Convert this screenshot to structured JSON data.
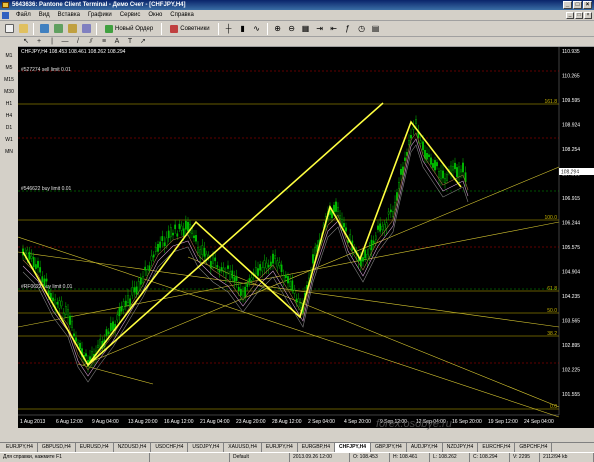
{
  "window": {
    "title": "5643636: Pantone Client Terminal - Демо Счет - [CHFJPY,H4]",
    "controls": [
      "_",
      "□",
      "×"
    ]
  },
  "menu": [
    "Файл",
    "Вид",
    "Вставка",
    "Графики",
    "Сервис",
    "Окно",
    "Справка"
  ],
  "toolbar": {
    "new_order_label": "Новый Ордер",
    "advisors_label": "Советники"
  },
  "timeframes": [
    "M1",
    "M5",
    "M15",
    "M30",
    "H1",
    "H4",
    "D1",
    "W1",
    "MN"
  ],
  "chart": {
    "header": "CHFJPY,H4  108.453 108.461 108.262 108.294",
    "labels": [
      "#527274 sell limit 0.01",
      "#546622 buy limit 0.01",
      "#RF0622 buy limit 0.01"
    ],
    "current_price": "108.294",
    "price_axis": [
      "110.935",
      "110.265",
      "109.595",
      "108.924",
      "108.254",
      "107.585",
      "106.915",
      "106.244",
      "105.575",
      "104.904",
      "104.235",
      "103.565",
      "102.895",
      "102.225",
      "101.555"
    ],
    "fib_labels": [
      "161.8",
      "100.0",
      "61.8",
      "50.0",
      "38.2",
      "23.6",
      "0.0"
    ],
    "time_axis": [
      "1 Aug 2013",
      "6 Aug 12:00",
      "9 Aug 04:00",
      "13 Aug 20:00",
      "16 Aug 12:00",
      "21 Aug 04:00",
      "23 Aug 20:00",
      "28 Aug 12:00",
      "2 Sep 04:00",
      "4 Sep 20:00",
      "9 Sep 12:00",
      "12 Sep 04:00",
      "16 Sep 20:00",
      "19 Sep 12:00",
      "24 Sep 04:00"
    ]
  },
  "tabs": [
    "EURJPY,H4",
    "GBPUSD,H4",
    "EURUSD,H4",
    "NZDUSD,H4",
    "USDCHF,H4",
    "USDJPY,H4",
    "XAUUSD,H4",
    "EURJPY,H4",
    "EURGBP,H4",
    "CHFJPY,H4",
    "GBPJPY,H4",
    "AUDJPY,H4",
    "NZDJPY,H4",
    "EURCHF,H4",
    "GBPCHF,H4"
  ],
  "active_tab_index": 9,
  "status": {
    "help": "Для справки, нажмите F1",
    "profile": "Default",
    "datetime": "2013.09.26 12:00",
    "open": "O: 108.453",
    "high": "H: 108.461",
    "low": "L: 108.262",
    "close": "C: 108.294",
    "volume": "V: 2295",
    "traffic": "2112/94 kb"
  },
  "watermark": "forex.osobye.ru",
  "colors": {
    "background": "#000000",
    "candle": "#00c000",
    "trendline": "#ffff40",
    "level": "#c8b400",
    "level_red": "#c00000",
    "axis_text": "#ffffff"
  }
}
